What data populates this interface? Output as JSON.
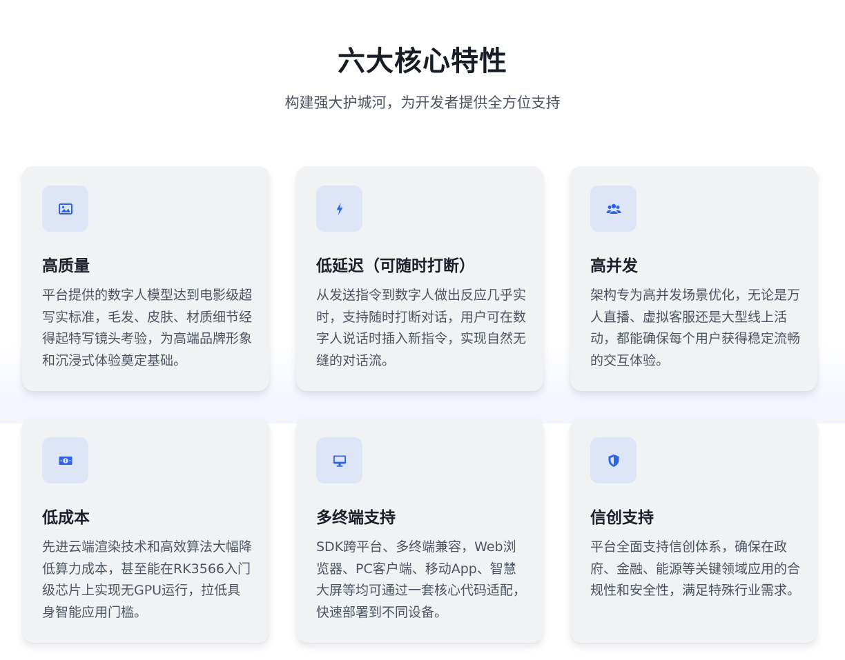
{
  "header": {
    "title": "六大核心特性",
    "subtitle": "构建强大护城河，为开发者提供全方位支持"
  },
  "accent_color": "#2b64e8",
  "features": [
    {
      "icon": "image-icon",
      "title": "高质量",
      "description": "平台提供的数字人模型达到电影级超写实标准，毛发、皮肤、材质细节经得起特写镜头考验，为高端品牌形象和沉浸式体验奠定基础。"
    },
    {
      "icon": "lightning-icon",
      "title": "低延迟（可随时打断）",
      "description": "从发送指令到数字人做出反应几乎实时，支持随时打断对话，用户可在数字人说话时插入新指令，实现自然无缝的对话流。"
    },
    {
      "icon": "users-icon",
      "title": "高并发",
      "description": "架构专为高并发场景优化，无论是万人直播、虚拟客服还是大型线上活动，都能确保每个用户获得稳定流畅的交互体验。"
    },
    {
      "icon": "money-icon",
      "title": "低成本",
      "description": "先进云端渲染技术和高效算法大幅降低算力成本，甚至能在RK3566入门级芯片上实现无GPU运行，拉低具身智能应用门槛。"
    },
    {
      "icon": "monitor-icon",
      "title": "多终端支持",
      "description": "SDK跨平台、多终端兼容，Web浏览器、PC客户端、移动App、智慧大屏等均可通过一套核心代码适配，快速部署到不同设备。"
    },
    {
      "icon": "shield-icon",
      "title": "信创支持",
      "description": "平台全面支持信创体系，确保在政府、金融、能源等关键领域应用的合规性和安全性，满足特殊行业需求。"
    }
  ]
}
